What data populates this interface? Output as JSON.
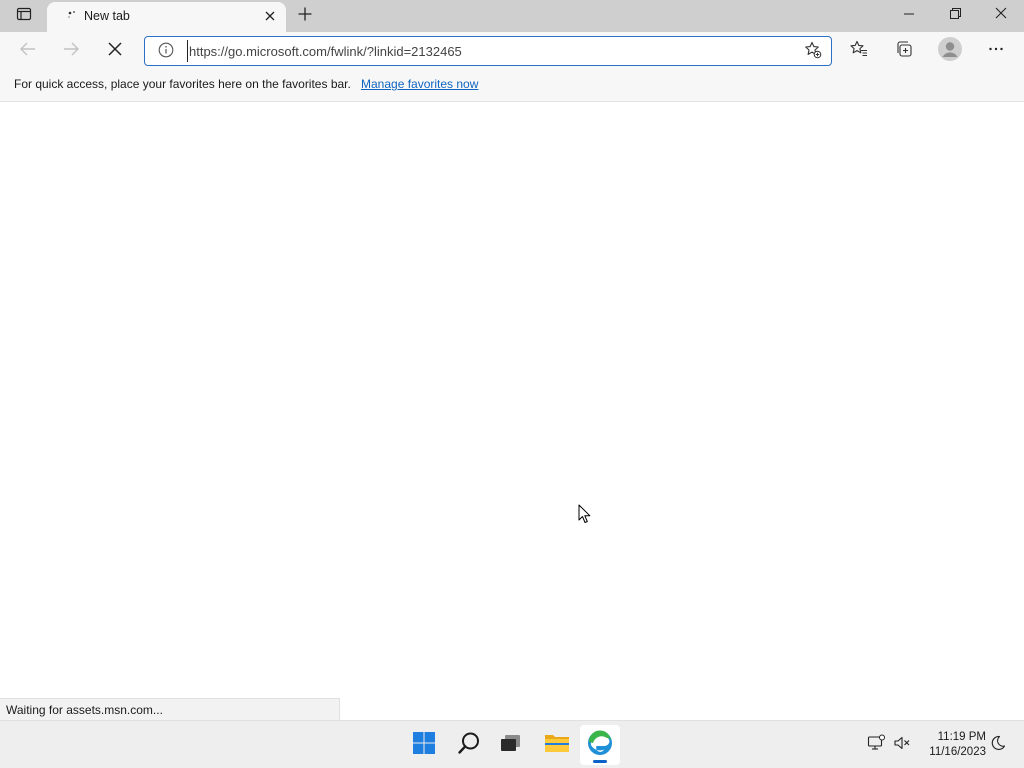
{
  "browser": {
    "tab": {
      "title": "New tab"
    },
    "toolbar": {
      "url": "https://go.microsoft.com/fwlink/?linkid=2132465"
    },
    "favorites_bar": {
      "message": "For quick access, place your favorites here on the favorites bar.",
      "link": "Manage favorites now"
    },
    "status_text": "Waiting for assets.msn.com..."
  },
  "taskbar": {
    "apps": [
      {
        "icon": "windows-start-icon"
      },
      {
        "icon": "search-icon"
      },
      {
        "icon": "task-view-icon"
      },
      {
        "icon": "file-explorer-icon"
      },
      {
        "icon": "edge-icon",
        "active": true
      }
    ],
    "clock": {
      "time": "11:19 PM",
      "date": "11/16/2023"
    }
  },
  "colors": {
    "accent": "#2f6fc7",
    "link": "#0f65c0",
    "taskbar_indicator": "#0a63c9"
  }
}
